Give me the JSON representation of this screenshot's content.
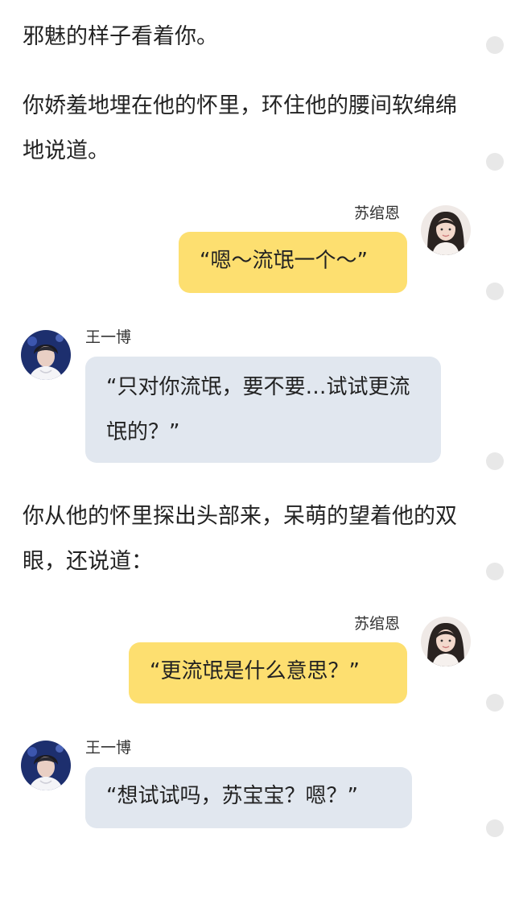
{
  "narration": [
    "邪魅的样子看着你。",
    "你娇羞地埋在他的怀里，环住他的腰间软绵绵地说道。",
    "你从他的怀里探出头部来，呆萌的望着他的双眼，还说道："
  ],
  "messages": [
    {
      "speaker": "苏绾恩",
      "text": "“嗯～流氓一个～”"
    },
    {
      "speaker": "王一博",
      "text": "“只对你流氓，要不要…试试更流氓的？”"
    },
    {
      "speaker": "苏绾恩",
      "text": "“更流氓是什么意思？”"
    },
    {
      "speaker": "王一博",
      "text": "“想试试吗，苏宝宝？嗯？”"
    }
  ],
  "colors": {
    "bubble_right": "#fddf70",
    "bubble_left": "#e1e7ef",
    "side_dot": "#e8e8e8"
  },
  "icons": {
    "avatar_right": "avatar-girl-icon",
    "avatar_left": "avatar-boy-icon"
  }
}
